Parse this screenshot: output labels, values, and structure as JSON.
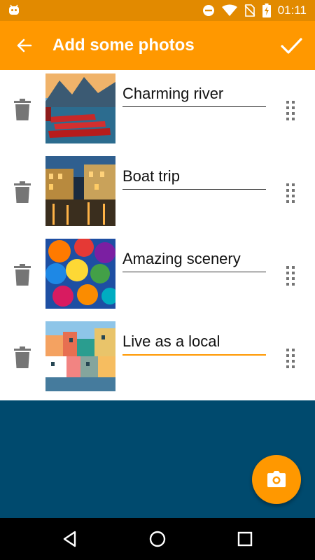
{
  "status_bar": {
    "time": "01:11",
    "left_icon": "android-notification-icon",
    "icons": [
      "do-not-disturb-icon",
      "wifi-icon",
      "no-sim-icon",
      "battery-charging-icon"
    ]
  },
  "app_bar": {
    "title": "Add some photos",
    "back_icon": "arrow-back-icon",
    "confirm_icon": "check-icon",
    "color": "#ff9800"
  },
  "photos": [
    {
      "caption": "Charming river",
      "image": "red boats on mountain lake"
    },
    {
      "caption": "Boat trip",
      "image": "venice canal at night"
    },
    {
      "caption": "Amazing scenery",
      "image": "colorful umbrellas"
    },
    {
      "caption": "Live as a local",
      "image": "colorful coastal houses"
    }
  ],
  "fab": {
    "icon": "camera-icon"
  },
  "nav_bar": {
    "icons": [
      "back-triangle-icon",
      "home-circle-icon",
      "recents-square-icon"
    ]
  },
  "colors": {
    "accent": "#ff9800",
    "status_bar": "#e28a00",
    "bottom_area": "#004a6e"
  }
}
